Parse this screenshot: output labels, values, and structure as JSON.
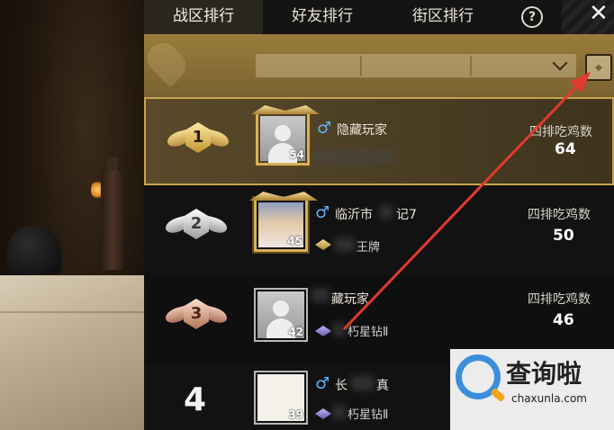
{
  "tabs": [
    {
      "label": "战区排行",
      "active": true
    },
    {
      "label": "好友排行",
      "active": false
    },
    {
      "label": "街区排行",
      "active": false
    }
  ],
  "header": {
    "help_glyph": "?",
    "close_glyph": "✕"
  },
  "filters": {
    "dropdown_1": "",
    "dropdown_2": "",
    "dropdown_3": "",
    "location_icon": "location-pin-icon"
  },
  "rows": [
    {
      "rank": "1",
      "level": "54",
      "name": "隐藏玩家",
      "tier": "",
      "stat_label": "四排吃鸡数",
      "stat_value": "64"
    },
    {
      "rank": "2",
      "level": "45",
      "name": "临沂市",
      "name_suffix": "记7",
      "tier": "王牌",
      "stat_label": "四排吃鸡数",
      "stat_value": "50"
    },
    {
      "rank": "3",
      "level": "42",
      "name": "藏玩家",
      "tier": "朽星钻Ⅱ",
      "stat_label": "四排吃鸡数",
      "stat_value": "46"
    },
    {
      "rank": "4",
      "level": "39",
      "name": "长",
      "name_suffix": "真",
      "tier": "朽星钻Ⅱ",
      "stat_label": "",
      "stat_value": ""
    }
  ],
  "watermark": {
    "cn": "查询啦",
    "en": "chaxunla.com"
  },
  "colors": {
    "accent_gold": "#c7a252",
    "male_blue": "#5fb3ff",
    "arrow_red": "#e23a2e"
  }
}
